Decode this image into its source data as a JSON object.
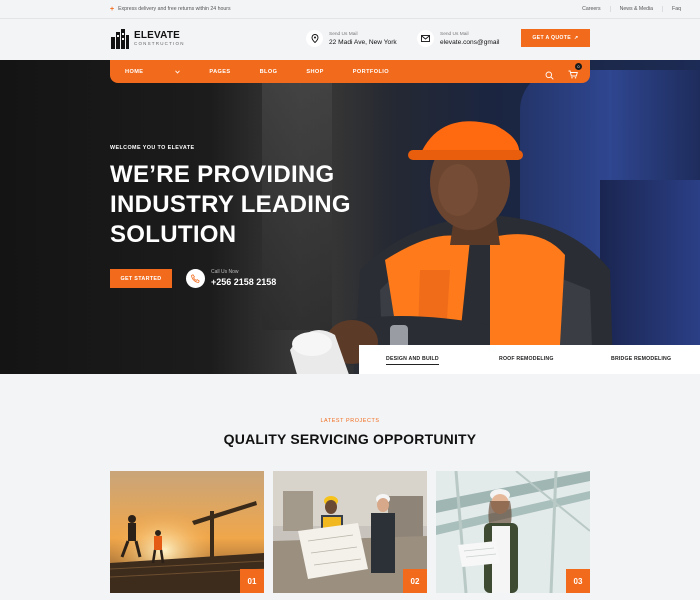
{
  "topbar": {
    "promo": "Express delivery and free returns within 24 hours",
    "links": [
      "Careers",
      "News & Media",
      "Faq"
    ]
  },
  "header": {
    "brand": "ELEVATE",
    "brand_sub": "CONSTRUCTION",
    "address_label": "Send Us Mail",
    "address_value": "22 Madi Ave, New York",
    "mail_label": "Send Us Mail",
    "mail_value": "elevate.cons@gmail",
    "quote_button": "GET A QUOTE"
  },
  "nav": {
    "items": [
      "HOME",
      "PAGES",
      "BLOG",
      "SHOP",
      "PORTFOLIO"
    ],
    "cart_count": "0"
  },
  "hero": {
    "welcome": "WELCOME YOU TO ELEVATE",
    "headline_lines": [
      "WE’RE PROVIDING",
      "INDUSTRY LEADING",
      "SOLUTION"
    ],
    "start_button": "GET STARTED",
    "call_label": "Call Us Now",
    "call_number": "+256 2158 2158"
  },
  "tabs": {
    "items": [
      "DESIGN AND BUILD",
      "ROOF REMODELING",
      "BRIDGE REMODELING"
    ],
    "active": "DESIGN AND BUILD"
  },
  "projects": {
    "eyebrow": "LATEST PROJECTS",
    "title": "QUALITY SERVICING OPPORTUNITY",
    "cards": [
      {
        "number": "01"
      },
      {
        "number": "02"
      },
      {
        "number": "03"
      }
    ]
  },
  "colors": {
    "accent": "#f26b1d",
    "background": "#f3f4f6",
    "text": "#111111"
  }
}
